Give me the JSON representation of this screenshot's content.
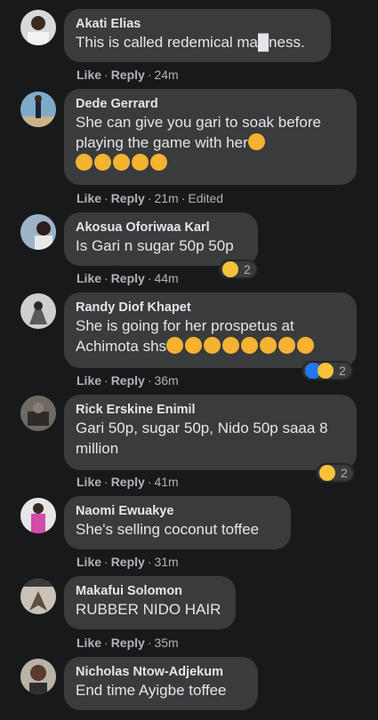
{
  "comments": [
    {
      "author": "Akati Elias",
      "text": "This is called redemical ma█ness.",
      "like": "Like",
      "reply": "Reply",
      "time": "24m",
      "edited": ""
    },
    {
      "author": "Dede Gerrard",
      "text": "She can give you gari to soak before playing the game with her",
      "like": "Like",
      "reply": "Reply",
      "time": "21m",
      "edited": "Edited"
    },
    {
      "author": "Akosua Oforiwaa Karl",
      "text": "Is Gari n sugar 50p 50p",
      "like": "Like",
      "reply": "Reply",
      "time": "44m",
      "reaction_count": "2"
    },
    {
      "author": "Randy Diof Khapet",
      "text": "She is going for her prospetus at Achimota shs",
      "like": "Like",
      "reply": "Reply",
      "time": "36m",
      "reaction_count": "2"
    },
    {
      "author": "Rick Erskine Enimil",
      "text": "Gari 50p, sugar 50p, Nido 50p saaa 8 million",
      "like": "Like",
      "reply": "Reply",
      "time": "41m",
      "reaction_count": "2"
    },
    {
      "author": "Naomi Ewuakye",
      "text": "She's selling coconut toffee",
      "like": "Like",
      "reply": "Reply",
      "time": "31m"
    },
    {
      "author": "Makafui Solomon",
      "text": "RUBBER NIDO HAIR",
      "like": "Like",
      "reply": "Reply",
      "time": "35m"
    },
    {
      "author": "Nicholas Ntow-Adjekum",
      "text": "End time Ayigbe toffee"
    }
  ],
  "colors": {
    "background": "#18191a",
    "bubble": "#3a3b3c",
    "text": "#e4e6eb",
    "secondary": "#b0b3b8",
    "emoji": "#f7c23a",
    "like_blue": "#2078f4"
  },
  "icons": {
    "inline_emoji_comment_2": "shushing-face-emoji",
    "inline_emoji_comment_4": "rolling-on-floor-laughing-emoji",
    "reaction_haha": "haha-reaction-icon",
    "reaction_like": "like-reaction-icon"
  }
}
